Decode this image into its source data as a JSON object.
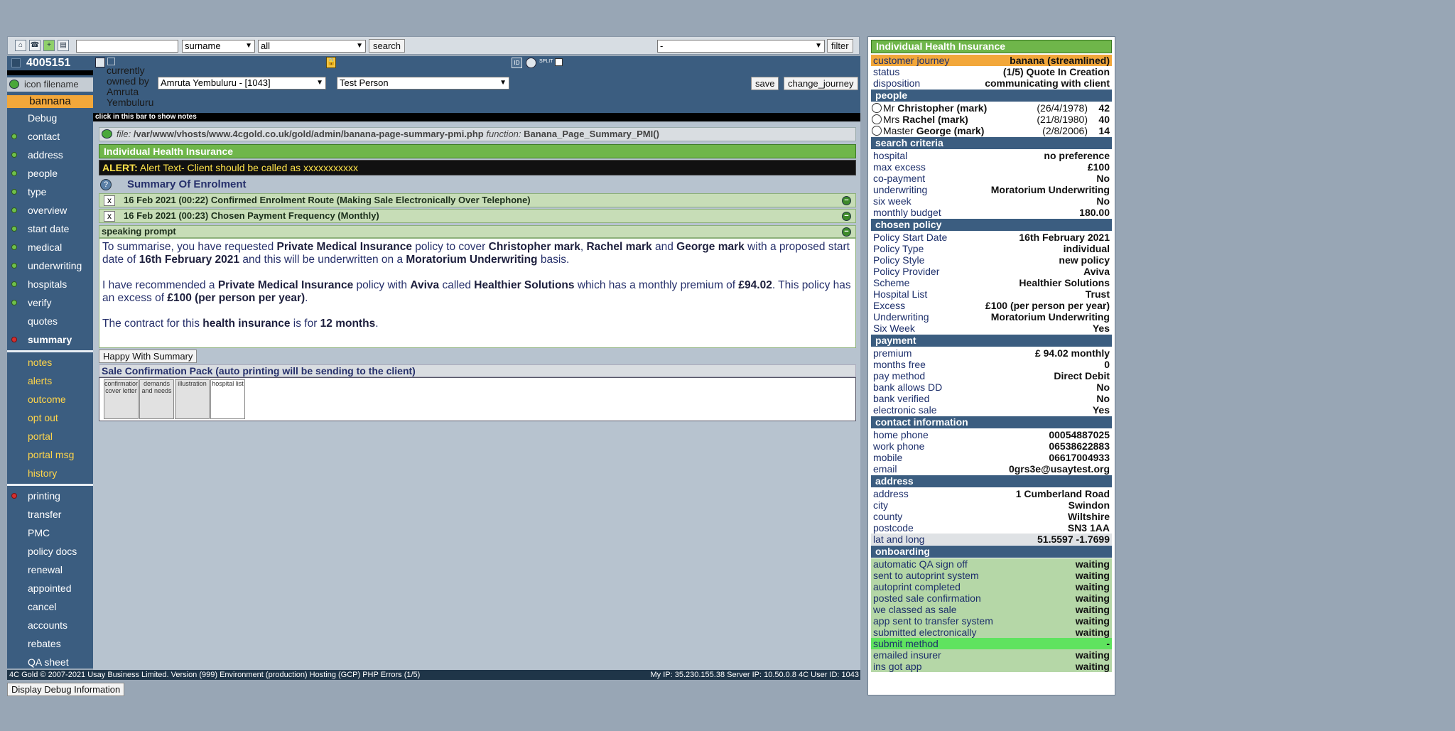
{
  "toolbar": {
    "search_value": "",
    "field_select": "surname",
    "scope_select": "all",
    "search_label": "search",
    "filter_select": "-",
    "filter_label": "filter"
  },
  "sidebar": {
    "record_id": "4005151",
    "icon_filename_label": "icon filename",
    "current_label": "bannana",
    "debug_label": "Debug",
    "items": [
      {
        "label": "contact",
        "status": "green"
      },
      {
        "label": "address",
        "status": "green"
      },
      {
        "label": "people",
        "status": "green"
      },
      {
        "label": "type",
        "status": "green"
      },
      {
        "label": "overview",
        "status": "green"
      },
      {
        "label": "start date",
        "status": "green"
      },
      {
        "label": "medical",
        "status": "green"
      },
      {
        "label": "underwriting",
        "status": "green"
      },
      {
        "label": "hospitals",
        "status": "green"
      },
      {
        "label": "verify",
        "status": "green"
      },
      {
        "label": "quotes",
        "status": "none"
      },
      {
        "label": "summary",
        "status": "red"
      }
    ],
    "sub_items": [
      "notes",
      "alerts",
      "outcome",
      "opt out",
      "portal",
      "portal msg",
      "history"
    ],
    "lower_items": [
      {
        "label": "printing",
        "status": "red"
      },
      {
        "label": "transfer",
        "status": "none"
      },
      {
        "label": "PMC",
        "status": "none"
      },
      {
        "label": "policy docs",
        "status": "none"
      },
      {
        "label": "renewal",
        "status": "none"
      },
      {
        "label": "appointed",
        "status": "none"
      },
      {
        "label": "cancel",
        "status": "none"
      },
      {
        "label": "accounts",
        "status": "none"
      },
      {
        "label": "rebates",
        "status": "none"
      },
      {
        "label": "QA sheet",
        "status": "none"
      }
    ]
  },
  "header": {
    "owned_by_text": "currently owned by Amruta Yembuluru",
    "owner_select": "Amruta Yembuluru - [1043]",
    "person_select": "Test Person",
    "save_label": "save",
    "change_journey_label": "change_journey",
    "split_label": "SPLIT",
    "notes_bar": "click in this bar to show notes"
  },
  "main": {
    "file_label": "file:",
    "file_path": "/var/www/vhosts/www.4cgold.co.uk/gold/admin/banana-page-summary-pmi.php",
    "function_label": "function:",
    "function_name": "Banana_Page_Summary_PMI()",
    "product_title": "Individual Health Insurance",
    "alert_label": "ALERT:",
    "alert_text": "Alert Text- Client should be called as xxxxxxxxxxx",
    "help_icon": "?",
    "summary_title": "Summary Of Enrolment",
    "events": [
      {
        "x": "x",
        "text": "16 Feb 2021 (00:22) Confirmed Enrolment Route (Making Sale Electronically Over Telephone)"
      },
      {
        "x": "x",
        "text": "16 Feb 2021 (00:23) Chosen Payment Frequency (Monthly)"
      }
    ],
    "speaking_prompt": "speaking prompt",
    "para1": {
      "t1": "To summarise, you have requested ",
      "b1": "Private Medical Insurance",
      "t2": " policy to cover ",
      "b2": "Christopher mark",
      "t3": ", ",
      "b3": "Rachel mark",
      "t4": " and ",
      "b4": "George mark",
      "t5": " with a proposed start date of ",
      "b5": "16th February 2021",
      "t6": " and this will be underwritten on a ",
      "b6": "Moratorium Underwriting",
      "t7": " basis."
    },
    "para2": {
      "t1": "I have recommended a ",
      "b1": "Private Medical Insurance",
      "t2": " policy with ",
      "b2": "Aviva",
      "t3": " called ",
      "b3": "Healthier Solutions",
      "t4": " which has a monthly premium of ",
      "b4": "£94.02",
      "t5": ". This policy has an excess of ",
      "b5": "£100 (per person per year)",
      "t6": "."
    },
    "para3": {
      "t1": "The contract for this ",
      "b1": "health insurance",
      "t2": " is for ",
      "b2": "12 months",
      "t3": "."
    },
    "happy_button": "Happy With Summary",
    "pack_title": "Sale Confirmation Pack (auto printing will be sending to the client)",
    "pack_docs": [
      "confirmation cover letter",
      "demands and needs",
      "illustration",
      "hospital list"
    ]
  },
  "right": {
    "title": "Individual Health Insurance",
    "journey": {
      "k": "customer journey",
      "v": "banana (streamlined)"
    },
    "status": {
      "k": "status",
      "v": "(1/5) Quote In Creation"
    },
    "disposition": {
      "k": "disposition",
      "v": "communicating with client"
    },
    "people_head": "people",
    "people": [
      {
        "title": "Mr",
        "name": "Christopher (mark)",
        "dob": "(26/4/1978)",
        "age": "42"
      },
      {
        "title": "Mrs",
        "name": "Rachel (mark)",
        "dob": "(21/8/1980)",
        "age": "40"
      },
      {
        "title": "Master",
        "name": "George (mark)",
        "dob": "(2/8/2006)",
        "age": "14"
      }
    ],
    "search_head": "search criteria",
    "search": [
      {
        "k": "hospital",
        "v": "no preference"
      },
      {
        "k": "max excess",
        "v": "£100"
      },
      {
        "k": "co-payment",
        "v": "No"
      },
      {
        "k": "underwriting",
        "v": "Moratorium Underwriting"
      },
      {
        "k": "six week",
        "v": "No"
      },
      {
        "k": "monthly budget",
        "v": "180.00"
      }
    ],
    "policy_head": "chosen policy",
    "policy": [
      {
        "k": "Policy Start Date",
        "v": "16th February 2021"
      },
      {
        "k": "Policy Type",
        "v": "individual"
      },
      {
        "k": "Policy Style",
        "v": "new policy"
      },
      {
        "k": "Policy Provider",
        "v": "Aviva"
      },
      {
        "k": "Scheme",
        "v": "Healthier Solutions"
      },
      {
        "k": "Hospital List",
        "v": "Trust"
      },
      {
        "k": "Excess",
        "v": "£100 (per person per year)"
      },
      {
        "k": "Underwriting",
        "v": "Moratorium Underwriting"
      },
      {
        "k": "Six Week",
        "v": "Yes"
      }
    ],
    "payment_head": "payment",
    "payment": [
      {
        "k": "premium",
        "v": "£ 94.02 monthly"
      },
      {
        "k": "months free",
        "v": "0"
      },
      {
        "k": "pay method",
        "v": "Direct Debit"
      },
      {
        "k": "bank allows DD",
        "v": "No"
      },
      {
        "k": "bank verified",
        "v": "No"
      },
      {
        "k": "electronic sale",
        "v": "Yes"
      }
    ],
    "contact_head": "contact information",
    "contact": [
      {
        "k": "home phone",
        "v": "00054887025"
      },
      {
        "k": "work phone",
        "v": "06538622883"
      },
      {
        "k": "mobile",
        "v": "06617004933"
      },
      {
        "k": "email",
        "v": "0grs3e@usaytest.org"
      }
    ],
    "address_head": "address",
    "address": [
      {
        "k": "address",
        "v": "1 Cumberland Road"
      },
      {
        "k": "city",
        "v": "Swindon"
      },
      {
        "k": "county",
        "v": "Wiltshire"
      },
      {
        "k": "postcode",
        "v": "SN3 1AA"
      },
      {
        "k": "lat and long",
        "v": "51.5597 -1.7699"
      }
    ],
    "onboarding_head": "onboarding",
    "onboarding": [
      {
        "k": "automatic QA sign off",
        "v": "waiting"
      },
      {
        "k": "sent to autoprint system",
        "v": "waiting"
      },
      {
        "k": "autoprint completed",
        "v": "waiting"
      },
      {
        "k": "posted sale confirmation",
        "v": "waiting"
      },
      {
        "k": "we classed as sale",
        "v": "waiting"
      },
      {
        "k": "app sent to transfer system",
        "v": "waiting"
      },
      {
        "k": "submitted electronically",
        "v": "waiting"
      },
      {
        "k": "submit method",
        "v": "-"
      },
      {
        "k": "emailed insurer",
        "v": "waiting"
      },
      {
        "k": "ins got app",
        "v": "waiting"
      }
    ]
  },
  "footer": {
    "left": "4C Gold © 2007-2021 Usay Business Limited. Version (999) Environment (production) Hosting (GCP) PHP Errors (1/5)",
    "right": "My IP: 35.230.155.38 Server IP: 10.50.0.8 4C User ID: 1043",
    "debug_button": "Display Debug Information"
  },
  "colors": {
    "nav_blue": "#3b5d80",
    "green_header": "#6fb64a",
    "orange_highlight": "#f2a73a",
    "alert_yellow": "#ffe34a"
  }
}
